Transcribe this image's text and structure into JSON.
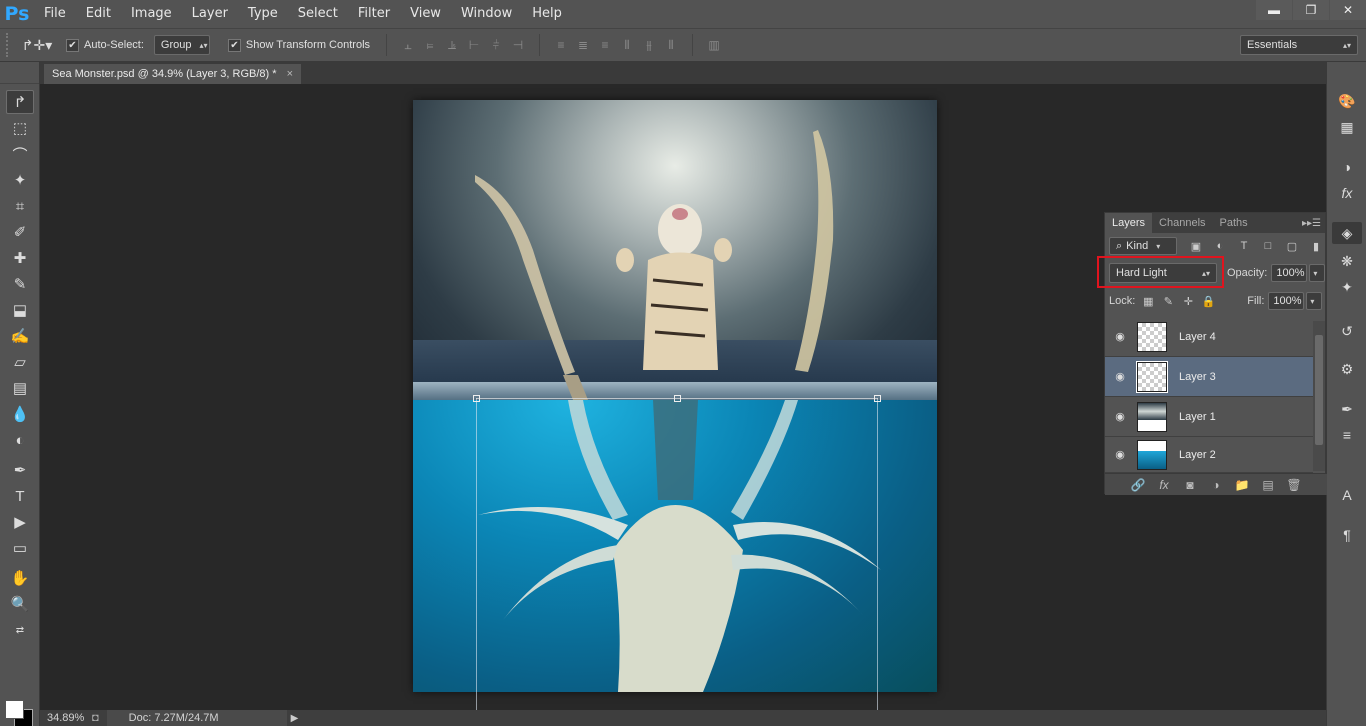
{
  "app": {
    "logo": "Ps"
  },
  "menu": [
    "File",
    "Edit",
    "Image",
    "Layer",
    "Type",
    "Select",
    "Filter",
    "View",
    "Window",
    "Help"
  ],
  "window_controls": {
    "minimize": "▬",
    "restore": "❐",
    "close": "✕"
  },
  "options": {
    "auto_select_label": "Auto-Select:",
    "auto_select_checked": true,
    "auto_select_value": "Group",
    "show_transform_label": "Show Transform Controls",
    "show_transform_checked": true,
    "workspace": "Essentials"
  },
  "document_tab": {
    "title": "Sea Monster.psd @ 34.9% (Layer 3, RGB/8) *",
    "close": "×"
  },
  "layers_panel": {
    "tabs": [
      "Layers",
      "Channels",
      "Paths"
    ],
    "active_tab": "Layers",
    "filter_kind": "Kind",
    "blend_mode": "Hard Light",
    "opacity_label": "Opacity:",
    "opacity": "100%",
    "lock_label": "Lock:",
    "fill_label": "Fill:",
    "fill": "100%",
    "layers": [
      {
        "name": "Layer 4",
        "selected": false
      },
      {
        "name": "Layer 3",
        "selected": true
      },
      {
        "name": "Layer 1",
        "selected": false
      },
      {
        "name": "Layer 2",
        "selected": false
      }
    ]
  },
  "status": {
    "zoom": "34.89%",
    "doc": "Doc: 7.27M/24.7M"
  },
  "colors": {
    "foreground": "#ffffff",
    "background": "#000000",
    "highlight": "#e0141e"
  }
}
